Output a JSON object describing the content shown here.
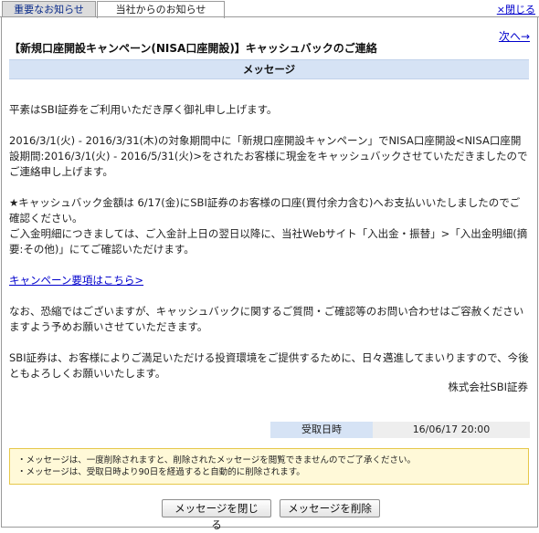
{
  "tabs": [
    {
      "label": "重要なお知らせ"
    },
    {
      "label": "当社からのお知らせ"
    }
  ],
  "close_label": "×閉じる",
  "next_label": "次へ→",
  "title": "【新規口座開設キャンペーン(NISA口座開設)】キャッシュバックのご連絡",
  "section_label": "メッセージ",
  "body": {
    "p1": "平素はSBI証券をご利用いただき厚く御礼申し上げます。",
    "p2": "2016/3/1(火) - 2016/3/31(木)の対象期間中に「新規口座開設キャンペーン」でNISA口座開設<NISA口座開設期間:2016/3/1(火) - 2016/5/31(火)>をされたお客様に現金をキャッシュバックさせていただきましたのでご連絡申し上げます。",
    "p3a": "★キャッシュバック金額は 6/17(金)にSBI証券のお客様の口座(買付余力含む)へお支払いいたしましたのでご確認ください。",
    "p3b": "ご入金明細につきましては、ご入金計上日の翌日以降に、当社Webサイト「入出金・振替」>「入出金明細(摘要:その他)」にてご確認いただけます。",
    "campaign_link": "キャンペーン要項はこちら>",
    "p4": "なお、恐縮ではございますが、キャッシュバックに関するご質問・ご確認等のお問い合わせはご容赦くださいますよう予めお願いさせていただきます。",
    "p5": "SBI証券は、お客様によりご満足いただける投資環境をご提供するために、日々邁進してまいりますので、今後ともよろしくお願いいたします。"
  },
  "signature": "株式会社SBI証券",
  "received": {
    "label": "受取日時",
    "value": "16/06/17 20:00"
  },
  "notice": [
    "・メッセージは、一度削除されますと、削除されたメッセージを閲覧できませんのでご了承ください。",
    "・メッセージは、受取日時より90日を経過すると自動的に削除されます。"
  ],
  "buttons": {
    "close": "メッセージを閉じる",
    "delete": "メッセージを削除"
  }
}
